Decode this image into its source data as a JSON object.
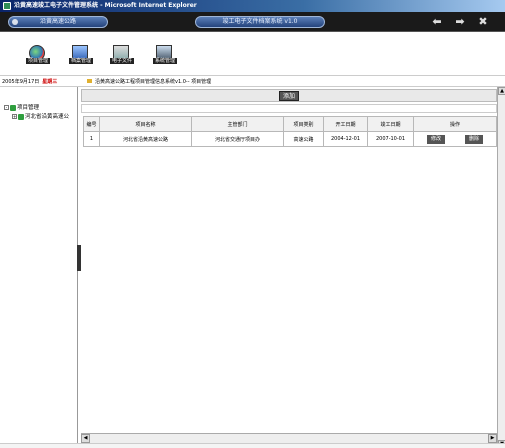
{
  "window": {
    "title": "沿黄高速竣工电子文件管理系统 - Microsoft Internet Explorer"
  },
  "banner": {
    "project_name": "沿黄高速公路",
    "system_name": "竣工电子文件档案系统 v1.0"
  },
  "toolbar": {
    "items": [
      {
        "label": "项目管理"
      },
      {
        "label": "档案管理"
      },
      {
        "label": "电子文件"
      },
      {
        "label": "系统管理"
      }
    ]
  },
  "status": {
    "date": "2005年9月17日",
    "weekday": "星期三"
  },
  "breadcrumb": "沿黄高速公路工程项目管理信息系统v1.0-- 项目管理",
  "sidebar": {
    "root": "项目管理",
    "child": "河北省沿黄高速公"
  },
  "main": {
    "add_label": "添加"
  },
  "table": {
    "headers": [
      "编号",
      "项目名称",
      "主管部门",
      "项目类别",
      "开工日期",
      "竣工日期",
      "操作"
    ],
    "rows": [
      {
        "no": "1",
        "name": "河北省沿黄高速公路",
        "dept": "河北省交通厅项目办",
        "category": "高速公路",
        "start": "2004-12-01",
        "end": "2007-10-01",
        "edit": "修改",
        "delete": "删除"
      }
    ]
  }
}
